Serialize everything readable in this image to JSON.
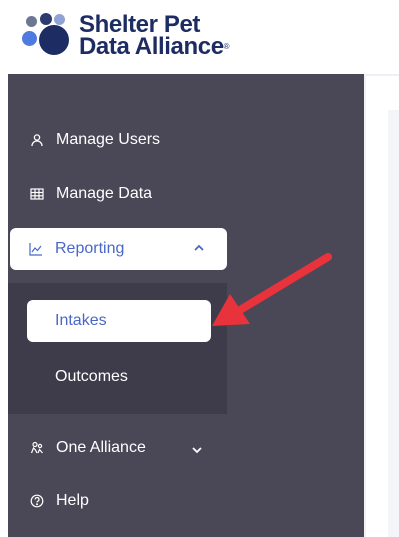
{
  "brand": {
    "line1": "Shelter Pet",
    "line2": "Data Alliance",
    "trademark": "®"
  },
  "sidebar": {
    "items": [
      {
        "label": "Manage Users",
        "icon": "user-icon"
      },
      {
        "label": "Manage Data",
        "icon": "table-icon"
      },
      {
        "label": "Reporting",
        "icon": "chart-icon",
        "expanded": true
      },
      {
        "label": "One Alliance",
        "icon": "people-icon",
        "expanded": false
      },
      {
        "label": "Help",
        "icon": "help-icon"
      }
    ],
    "reporting_sub": [
      {
        "label": "Intakes",
        "selected": true
      },
      {
        "label": "Outcomes",
        "selected": false
      }
    ]
  },
  "colors": {
    "sidebar": "#4a4757",
    "submenu": "#3e3b4a",
    "accent": "#4a67c7",
    "arrow": "#e8333c",
    "brand": "#1d2d63"
  }
}
